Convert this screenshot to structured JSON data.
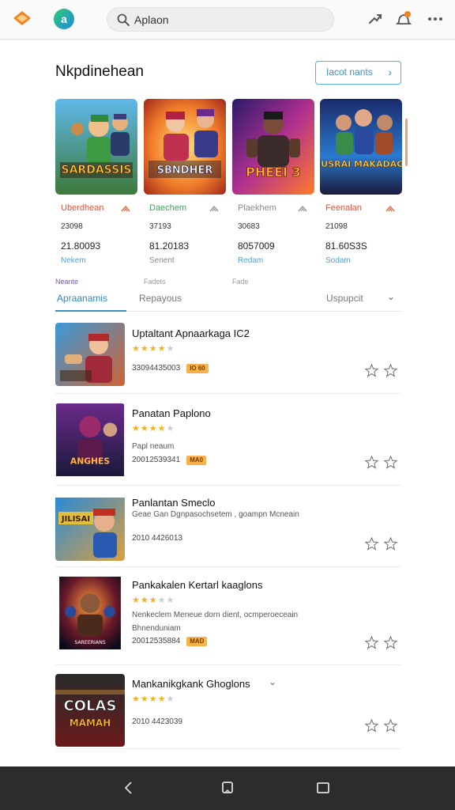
{
  "topbar": {
    "logo_icon": "app-logo-icon",
    "app_badge": "a",
    "search_placeholder": "Search",
    "search_value": "Aplaon",
    "icons": [
      "share-icon",
      "notification-icon",
      "more-icon"
    ],
    "accent": "#f5821f"
  },
  "featured": {
    "title": "Nkpdinehean",
    "see_more_label": "Iacot nants",
    "cards": [
      {
        "name": "Uberdhean",
        "line1": "23098",
        "line2": "21.80093",
        "line3": "Nekem",
        "footer": "Neante",
        "name_color": "#e0543b",
        "thumb_text": "SARDASSIS"
      },
      {
        "name": "Daechem",
        "line1": "37193",
        "line2": "81.20183",
        "line3": "Senent",
        "footer": "Fadets",
        "name_color": "#3aa55a",
        "thumb_text": "SBNDHER"
      },
      {
        "name": "Plaekhem",
        "line1": "30683",
        "line2": "8057009",
        "line3": "Redam",
        "footer": "Fade",
        "name_color": "#8a8a8a",
        "thumb_text": "PHEEI 3"
      },
      {
        "name": "Feenalan",
        "line1": "21098",
        "line2": "81.60S3S",
        "line3": "Sodam",
        "footer": "",
        "name_color": "#e0543b",
        "thumb_text": "MUSRAI MAKADAGE"
      }
    ]
  },
  "tabs": {
    "items": [
      "Apraanamis",
      "Repayous"
    ],
    "dropdown_label": "Uspupcit"
  },
  "list": [
    {
      "title": "Uptaltant Apnaarkaga IC2",
      "rating": 3.5,
      "desc": "",
      "desc2": "",
      "meta": "33094435003",
      "badge": "IO 60"
    },
    {
      "title": "Panatan Paplono",
      "rating": 3.5,
      "desc": "Papl neaum",
      "desc2": "",
      "meta": "20012539341",
      "badge": "MA0"
    },
    {
      "title": "Panlantan Smeclo",
      "rating": 0,
      "desc": "Geae Gan Dgnpasochsetem , goampn Mcneain",
      "desc2": "",
      "meta": "2010 4426013",
      "badge": ""
    },
    {
      "title": "Pankakalen Kertarl kaaglons",
      "rating": 3,
      "desc": "Nenkeclem Meneue dorn dient, ocmperoeceain",
      "desc2": "Bhnenduniam",
      "meta": "20012535884",
      "badge": "MAD"
    },
    {
      "title": "Mankanikgkank Ghoglons",
      "rating": 3.5,
      "desc": "",
      "desc2": "",
      "meta": "2010 4423039",
      "badge": "",
      "thumb_text": "COLAS MAMAH"
    }
  ],
  "navbar": {
    "icons": [
      "back-icon",
      "home-icon",
      "recents-icon"
    ]
  }
}
